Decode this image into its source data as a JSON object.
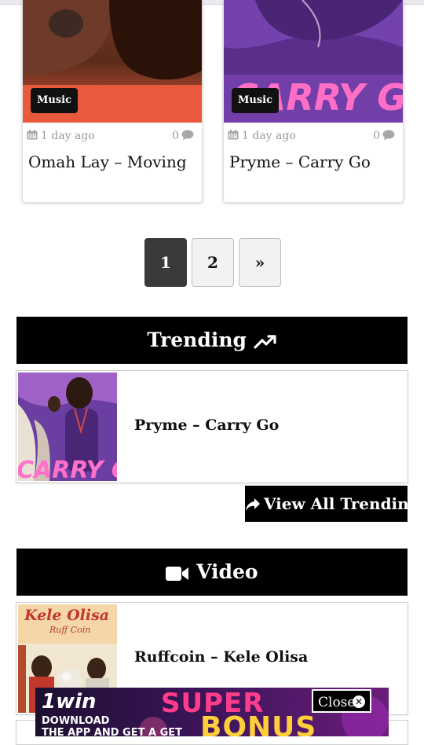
{
  "cards": [
    {
      "badge": "Music",
      "date": "1 day ago",
      "comments": "0",
      "title": "Omah Lay – Moving"
    },
    {
      "badge": "Music",
      "date": "1 day ago",
      "comments": "0",
      "title": "Pryme – Carry Go"
    }
  ],
  "pagination": {
    "pages": [
      "1",
      "2"
    ],
    "next": "»",
    "current": "1"
  },
  "trending": {
    "heading": "Trending",
    "item_title": "Pryme – Carry Go",
    "view_all": "View All Trending"
  },
  "video": {
    "heading": "Video",
    "item_title": "Ruffcoin – Kele Olisa"
  },
  "ad": {
    "brand": "1win",
    "line1": "DOWNLOAD",
    "line2": "THE APP AND GET A GET",
    "big1": "SUPER",
    "big2": "BONUS",
    "close_label": "Close"
  },
  "colors": {
    "header_bg": "#000000",
    "active_page": "#3a3a3a",
    "meta_text": "#9a9a9a"
  }
}
